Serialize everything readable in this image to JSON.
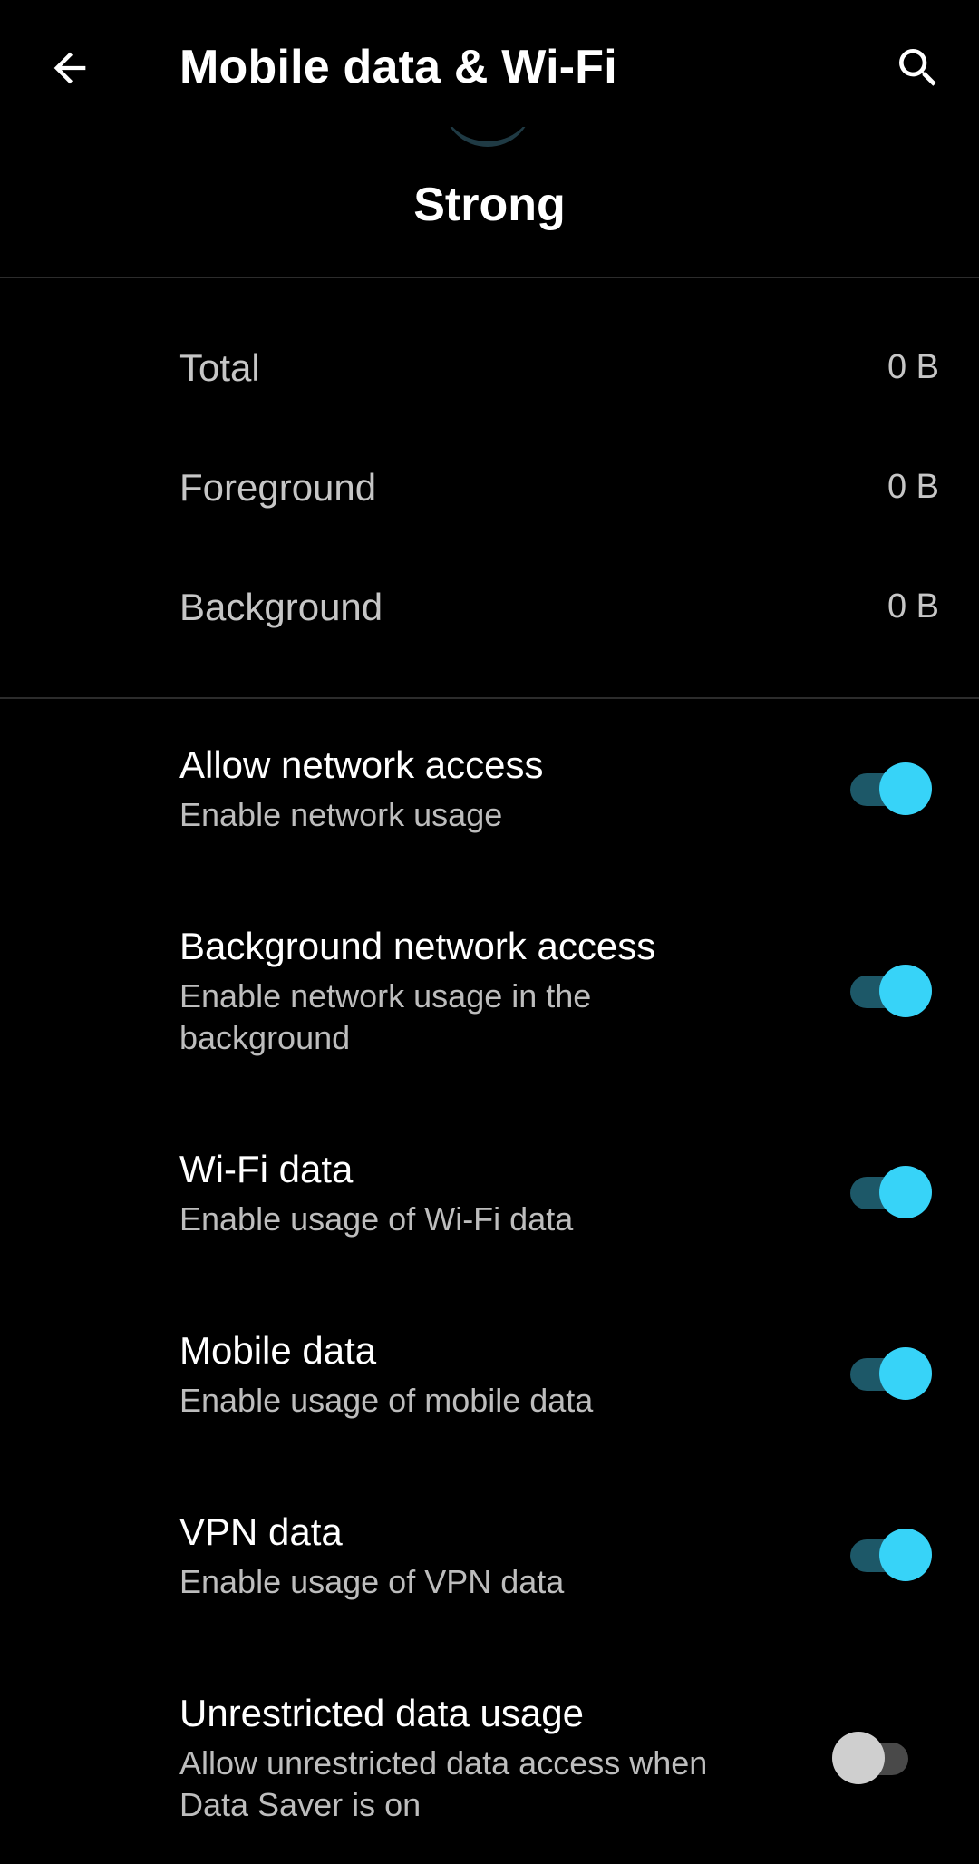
{
  "header": {
    "title": "Mobile data & Wi-Fi",
    "back_icon": "arrow-back-icon",
    "search_icon": "search-icon"
  },
  "signal": {
    "strength_label": "Strong"
  },
  "usage": {
    "rows": [
      {
        "label": "Total",
        "value": "0 B"
      },
      {
        "label": "Foreground",
        "value": "0 B"
      },
      {
        "label": "Background",
        "value": "0 B"
      }
    ]
  },
  "settings": [
    {
      "title": "Allow network access",
      "subtitle": "Enable network usage",
      "enabled": true
    },
    {
      "title": "Background network access",
      "subtitle": "Enable network usage in the background",
      "enabled": true
    },
    {
      "title": "Wi-Fi data",
      "subtitle": "Enable usage of Wi-Fi data",
      "enabled": true
    },
    {
      "title": "Mobile data",
      "subtitle": "Enable usage of mobile data",
      "enabled": true
    },
    {
      "title": "VPN data",
      "subtitle": "Enable usage of VPN data",
      "enabled": true
    },
    {
      "title": "Unrestricted data usage",
      "subtitle": "Allow unrestricted data access when Data Saver is on",
      "enabled": false
    }
  ],
  "colors": {
    "background": "#000000",
    "accent": "#37d3f8",
    "accent_track": "#1d5868",
    "off_thumb": "#cfcfcf",
    "off_track": "#494949"
  }
}
